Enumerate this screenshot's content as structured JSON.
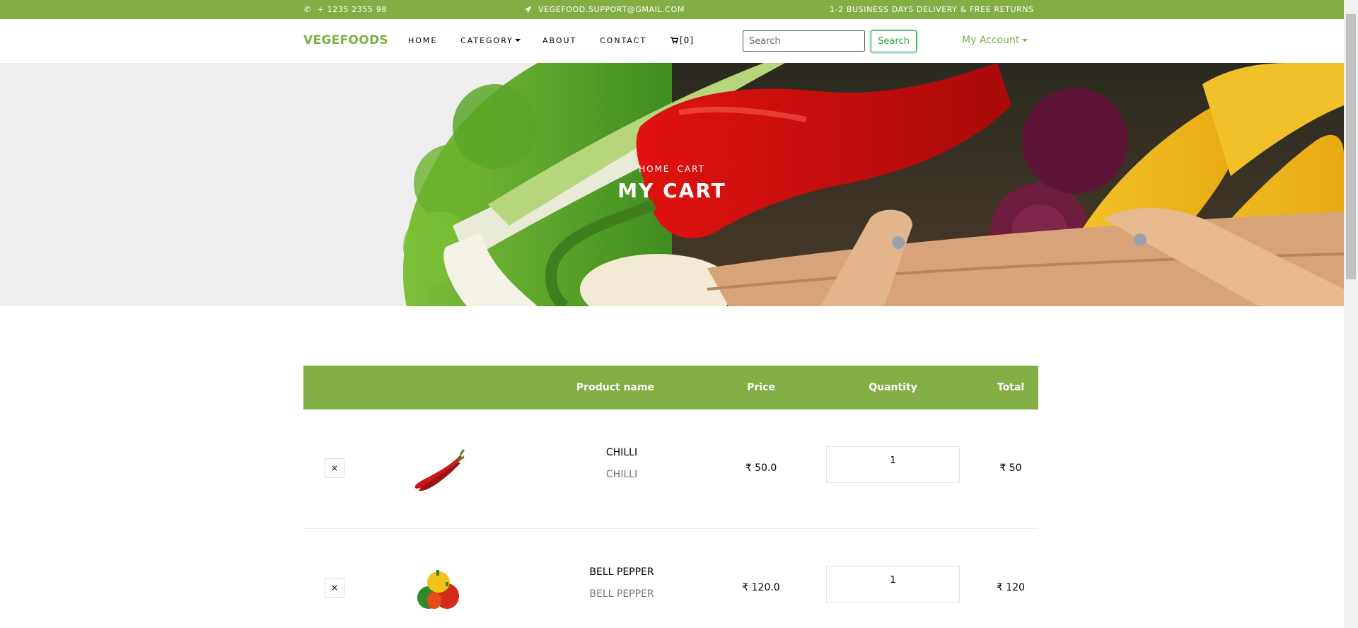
{
  "topbar": {
    "phone": "+ 1235 2355 98",
    "email": "VEGEFOOD.SUPPORT@GMAIL.COM",
    "delivery": "1-2 BUSINESS DAYS DELIVERY & FREE RETURNS"
  },
  "nav": {
    "brand": "VEGEFOODS",
    "home": "HOME",
    "category": "CATEGORY",
    "about": "ABOUT",
    "contact": "CONTACT",
    "cart_count": "[0]",
    "search_placeholder": "Search",
    "search_button": "Search",
    "account": "My Account"
  },
  "hero": {
    "breadcrumb_home": "HOME",
    "breadcrumb_current": "CART",
    "title": "MY CART"
  },
  "table": {
    "headers": {
      "product_name": "Product name",
      "price": "Price",
      "quantity": "Quantity",
      "total": "Total"
    },
    "rows": [
      {
        "remove": "×",
        "name": "CHILLI",
        "description": "CHILLI",
        "price": "₹ 50.0",
        "quantity": "1",
        "total": "₹ 50"
      },
      {
        "remove": "×",
        "name": "BELL PEPPER",
        "description": "BELL PEPPER",
        "price": "₹ 120.0",
        "quantity": "1",
        "total": "₹ 120"
      }
    ]
  },
  "colors": {
    "accent": "#82ae46",
    "search_button": "#28a745"
  },
  "icons": {
    "phone": "phone-icon",
    "email": "paper-plane-icon",
    "cart": "cart-icon",
    "remove": "close-icon"
  }
}
